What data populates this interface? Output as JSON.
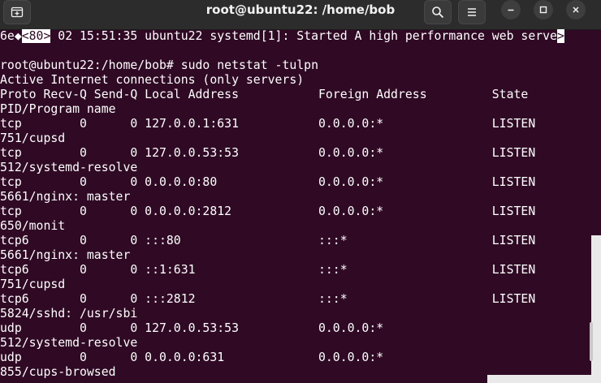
{
  "window": {
    "title": "root@ubuntu22: /home/bob",
    "new_tab_icon": "new-tab-icon",
    "search_icon": "search-icon",
    "menu_icon": "hamburger-menu-icon",
    "minimize_icon": "minimize-icon",
    "maximize_icon": "maximize-icon",
    "close_icon": "close-icon"
  },
  "terminal": {
    "log_prefix": "6e◆",
    "log_highlight": "<80>",
    "log_text": " 02 15:51:35 ubuntu22 systemd[1]: Started A high performance web serve",
    "log_end": ">",
    "prompt": "root@ubuntu22:/home/bob# sudo netstat -tulpn",
    "lines": [
      "Active Internet connections (only servers)",
      "Proto Recv-Q Send-Q Local Address           Foreign Address         State",
      "PID/Program name",
      "tcp        0      0 127.0.0.1:631           0.0.0.0:*               LISTEN",
      "751/cupsd",
      "tcp        0      0 127.0.0.53:53           0.0.0.0:*               LISTEN",
      "512/systemd-resolve",
      "tcp        0      0 0.0.0.0:80              0.0.0.0:*               LISTEN",
      "5661/nginx: master",
      "tcp        0      0 0.0.0.0:2812            0.0.0.0:*               LISTEN",
      "650/monit",
      "tcp6       0      0 :::80                   :::*                    LISTEN",
      "5661/nginx: master",
      "tcp6       0      0 ::1:631                 :::*                    LISTEN",
      "751/cupsd",
      "tcp6       0      0 :::2812                 :::*                    LISTEN",
      "5824/sshd: /usr/sbi",
      "udp        0      0 127.0.0.53:53           0.0.0.0:*",
      "512/systemd-resolve",
      "udp        0      0 0.0.0.0:631             0.0.0.0:*",
      "855/cups-browsed"
    ]
  },
  "colors": {
    "terminal_bg": "#300a24",
    "titlebar_bg": "#2c2c2c",
    "text": "#ffffff"
  }
}
